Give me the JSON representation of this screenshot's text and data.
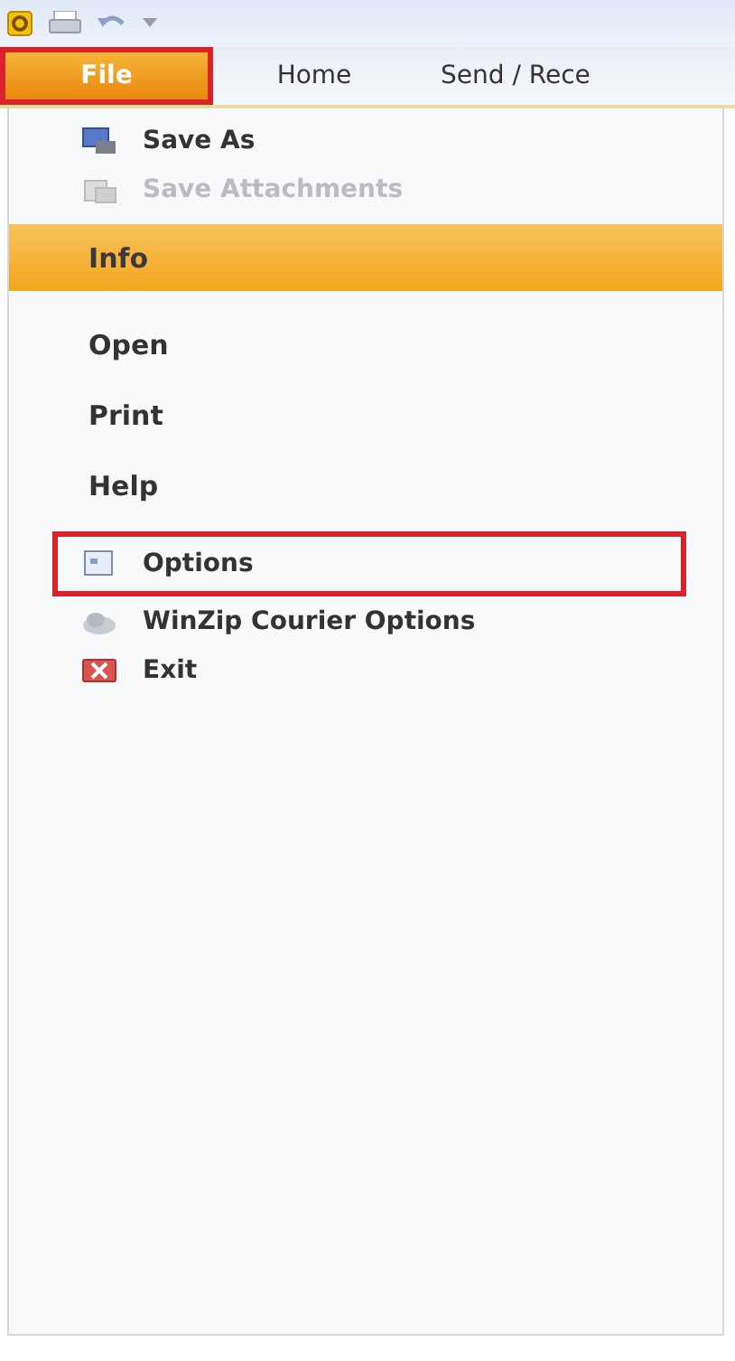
{
  "ribbon_tabs": [
    {
      "label": "File",
      "selected": true,
      "highlighted": true
    },
    {
      "label": "Home",
      "selected": false,
      "highlighted": false
    },
    {
      "label": "Send / Rece",
      "selected": false,
      "highlighted": false
    }
  ],
  "menu_items": [
    {
      "kind": "command",
      "label": "Save As",
      "disabled": false,
      "highlighted": false
    },
    {
      "kind": "command",
      "label": "Save Attachments",
      "disabled": true,
      "highlighted": false
    },
    {
      "kind": "tab",
      "label": "Info",
      "selected": true
    },
    {
      "kind": "tab",
      "label": "Open",
      "selected": false
    },
    {
      "kind": "tab",
      "label": "Print",
      "selected": false
    },
    {
      "kind": "tab",
      "label": "Help",
      "selected": false
    },
    {
      "kind": "command",
      "label": "Options",
      "disabled": false,
      "highlighted": true
    },
    {
      "kind": "command",
      "label": "WinZip Courier Options",
      "disabled": false,
      "highlighted": false
    },
    {
      "kind": "command",
      "label": "Exit",
      "disabled": false,
      "highlighted": false
    }
  ]
}
